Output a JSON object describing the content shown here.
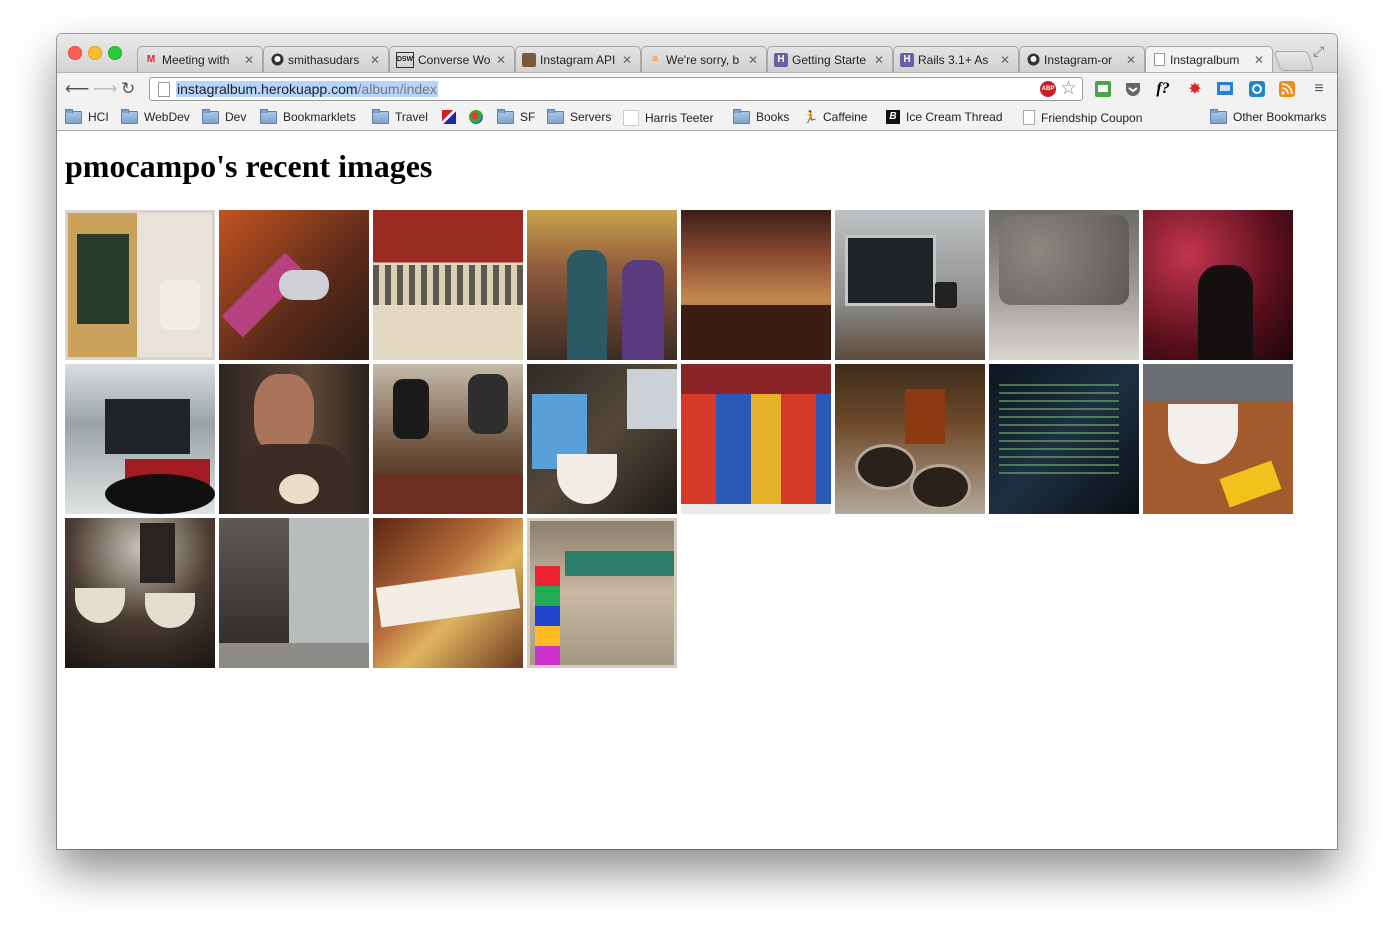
{
  "tabs": [
    {
      "title": "Meeting with",
      "icon": "gmail-icon",
      "active": false
    },
    {
      "title": "smithasudars",
      "icon": "github-icon",
      "active": false
    },
    {
      "title": "Converse Wo",
      "icon": "dsw-icon",
      "active": false
    },
    {
      "title": "Instagram API",
      "icon": "instagram-icon",
      "active": false
    },
    {
      "title": "We're sorry, b",
      "icon": "stackoverflow-icon",
      "active": false
    },
    {
      "title": "Getting Starte",
      "icon": "heroku-icon",
      "active": false
    },
    {
      "title": "Rails 3.1+ As",
      "icon": "heroku-icon",
      "active": false
    },
    {
      "title": "Instagram-or",
      "icon": "github-icon",
      "active": false
    },
    {
      "title": "Instagralbum",
      "icon": "page-icon",
      "active": true
    }
  ],
  "toolbar": {
    "url_host": "instagralbum.herokuapp.com",
    "url_path": "/album/index",
    "abp_label": "ABP"
  },
  "bookmarks": [
    {
      "label": "HCI",
      "type": "folder"
    },
    {
      "label": "WebDev",
      "type": "folder"
    },
    {
      "label": "Dev",
      "type": "folder"
    },
    {
      "label": "Bookmarklets",
      "type": "folder"
    },
    {
      "label": "Travel",
      "type": "folder"
    },
    {
      "label": "",
      "type": "flag-icon"
    },
    {
      "label": "",
      "type": "puzzle-icon"
    },
    {
      "label": "SF",
      "type": "folder"
    },
    {
      "label": "Servers",
      "type": "folder"
    },
    {
      "label": "Harris Teeter",
      "type": "page"
    },
    {
      "label": "Books",
      "type": "folder"
    },
    {
      "label": "Caffeine",
      "type": "runner-icon"
    },
    {
      "label": "Ice Cream Thread",
      "type": "b-icon"
    },
    {
      "label": "Friendship Coupon",
      "type": "page"
    },
    {
      "label": "Other Bookmarks",
      "type": "folder"
    }
  ],
  "page": {
    "heading": "pmocampo's recent images"
  },
  "photos": [
    {
      "subject": "ice cream cup with chalkboard menu"
    },
    {
      "subject": "sneaker on pedal"
    },
    {
      "subject": "roller derby arena"
    },
    {
      "subject": "two people in coffee shop"
    },
    {
      "subject": "coffee shop counter"
    },
    {
      "subject": "laptop by window"
    },
    {
      "subject": "climbing wall"
    },
    {
      "subject": "red-lit party"
    },
    {
      "subject": "laptop and notebook by window"
    },
    {
      "subject": "smiling woman with latte"
    },
    {
      "subject": "baristas with latte art"
    },
    {
      "subject": "coffee cups and pop tarts box"
    },
    {
      "subject": "pop tarts shelf"
    },
    {
      "subject": "coffee bag and cups"
    },
    {
      "subject": "terminal screen"
    },
    {
      "subject": "frozen yogurt with m&ms"
    },
    {
      "subject": "french press and cups"
    },
    {
      "subject": "street with buildings"
    },
    {
      "subject": "escazu artisan chocolates sign"
    },
    {
      "subject": "oak city sign and alley"
    }
  ]
}
